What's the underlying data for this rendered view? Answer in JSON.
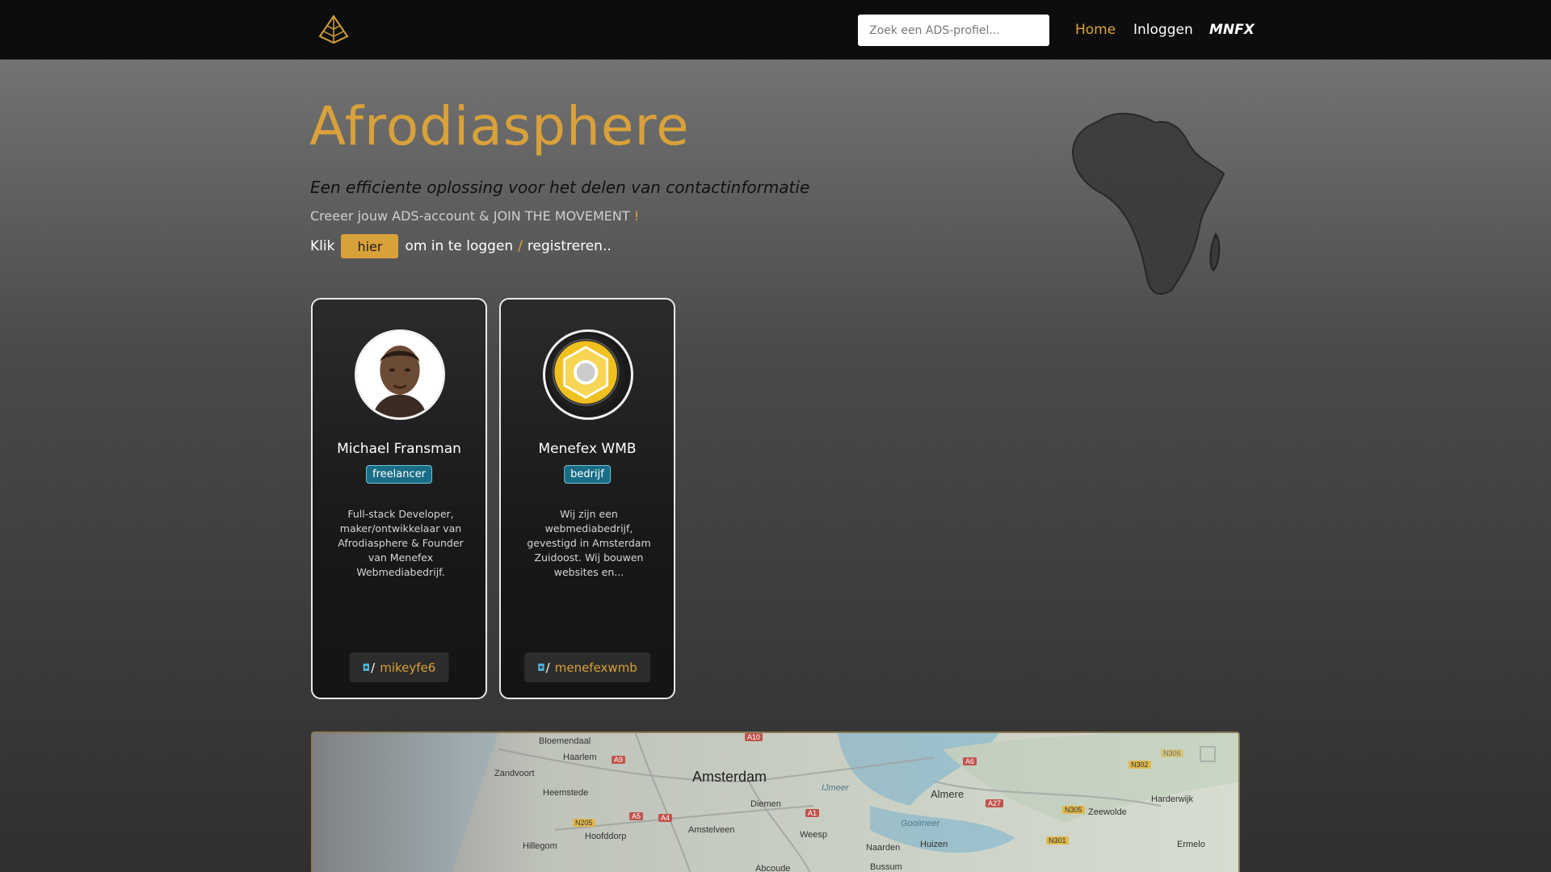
{
  "header": {
    "search_placeholder": "Zoek een ADS-profiel...",
    "nav": {
      "home": "Home",
      "login": "Inloggen",
      "brand": "MNFX"
    },
    "colors": {
      "accent": "#d9a13a",
      "bar": "#0d0d0d"
    },
    "logo_icon": "pyramid-logo-icon"
  },
  "hero": {
    "title": "Afrodiasphere",
    "subtitle": "Een efficiente oplossing voor het delen van contactinformatie",
    "cta_text": "Creeer jouw ADS-account & JOIN THE MOVEMENT",
    "cta_excl": "!",
    "klik": "Klik",
    "hier_button": "hier",
    "login_text": "om in te loggen",
    "slash": "/",
    "register_text": "registreren.."
  },
  "profiles": [
    {
      "name": "Michael Fransman",
      "badge": "freelancer",
      "description": "Full-stack Developer, maker/ontwikkelaar van Afrodiasphere & Founder van Menefex Webmediabedrijf.",
      "handle_slash": "/",
      "handle": "mikeyfe6",
      "avatar_icon": "person-avatar-icon"
    },
    {
      "name": "Menefex WMB",
      "badge": "bedrijf",
      "description": "Wij zijn een webmediabedrijf, gevestigd in Amsterdam Zuidoost. Wij bouwen websites en...",
      "handle_slash": "/",
      "handle": "menefexwmb",
      "avatar_icon": "hexagon-logo-icon"
    }
  ],
  "map": {
    "labels": [
      "Bloemendaal",
      "Haarlem",
      "Zandvoort",
      "Heemstede",
      "Amsterdam",
      "Diemen",
      "Amstelveen",
      "Weesp",
      "Hoofddorp",
      "Hillegom",
      "Almere",
      "Zeewolde",
      "Harderwijk",
      "Ermelo",
      "Naarden",
      "Huizen",
      "Bussum",
      "Abcoude",
      "Gooimeer",
      "IJmeer"
    ],
    "roads": [
      "A10",
      "A9",
      "A4",
      "A5",
      "N205",
      "A1",
      "A6",
      "A27",
      "N302",
      "N305",
      "N301",
      "N306"
    ]
  }
}
